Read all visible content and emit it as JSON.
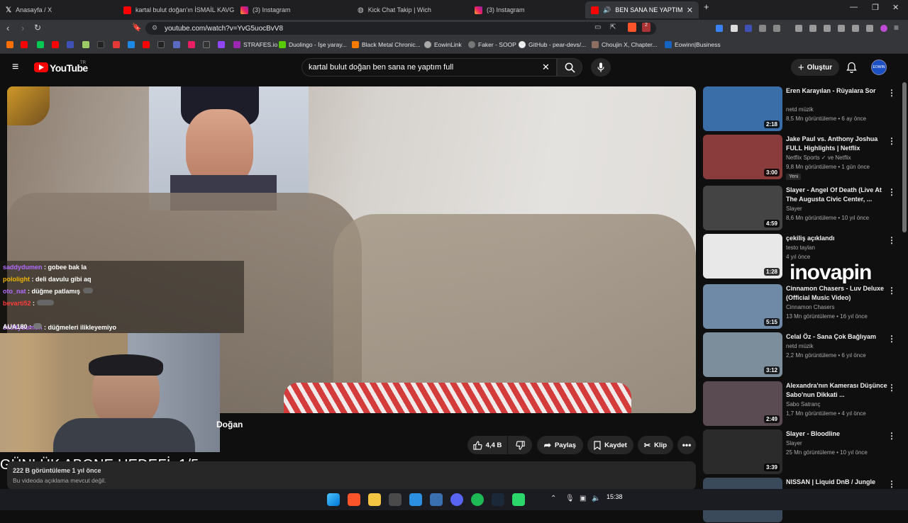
{
  "browser": {
    "tabs": [
      {
        "title": "Anasayfa / X",
        "icon": "x-logo-icon"
      },
      {
        "title": "kartal bulut doğan'ın İSMAİL KAVGA",
        "icon": "youtube-icon"
      },
      {
        "title": "(3) Instagram",
        "icon": "instagram-icon"
      },
      {
        "title": "Kick Chat Takip | Wich",
        "icon": "globe-icon"
      },
      {
        "title": "(3) Instagram",
        "icon": "instagram-icon"
      },
      {
        "title": "BEN SANA NE YAPTIM (Saygı",
        "icon": "youtube-icon"
      }
    ],
    "new_tab": "+",
    "url": "youtube.com/watch?v=YvG5uocBvV8",
    "shield_badge": "2",
    "bookmarks": [
      {
        "label": "STRAFES.io",
        "icon": "strafes-icon"
      },
      {
        "label": "Duolingo - İşe yaray...",
        "icon": "duolingo-icon"
      },
      {
        "label": "Black Metal Chronic...",
        "icon": "blogger-icon"
      },
      {
        "label": "EowinLink",
        "icon": "globe-icon"
      },
      {
        "label": "Faker - SOOP",
        "icon": "soop-icon"
      },
      {
        "label": "GitHub - pear-devs/...",
        "icon": "github-icon"
      },
      {
        "label": "Choujin X, Chapter...",
        "icon": "manga-icon"
      },
      {
        "label": "Eowinn|Business",
        "icon": "business-icon"
      }
    ]
  },
  "youtube": {
    "logo": "YouTube",
    "logo_country": "TR",
    "search_query": "kartal bulut doğan ben sana ne yaptım full",
    "create_label": "Oluştur",
    "avatar_text": "EOWIN"
  },
  "overlay": {
    "chat": [
      {
        "user": "saddydumen",
        "msg": "gobee bak la",
        "color": "#b36bff"
      },
      {
        "user": "pololight",
        "msg": "deli davulu gibi aq",
        "color": "#f0b400"
      },
      {
        "user": "oto_nat",
        "msg": "düğme patlamış",
        "color": "#b36bff"
      },
      {
        "user": "bevarti52",
        "msg": "",
        "color": "#ff3b3b"
      },
      {
        "user": "saddydumen",
        "msg": "düğmeleri ilikleyemiyo",
        "color": "#b36bff"
      },
      {
        "user": "AUA180",
        "msg": "",
        "color": "#ffffff"
      }
    ],
    "goal_text": "GÜNLÜK ABONE HEDEFİ: 1/5",
    "watermark": "inovapin"
  },
  "video": {
    "title_fragment": "Doğan",
    "likes": "4,4 B",
    "share_label": "Paylaş",
    "save_label": "Kaydet",
    "clip_label": "Klip",
    "views": "222 B görüntüleme  1 yıl önce",
    "no_description": "Bu videoda açıklama mevcut değil."
  },
  "recommendations": [
    {
      "title": "Eren Karayılan - Rüyalara Sor",
      "channel": "netd müzik",
      "meta": "8,5 Mn görüntüleme • 6 ay önce",
      "duration": "2:18",
      "thumb_color": "#3a6ea8"
    },
    {
      "title": "Jake Paul vs. Anthony Joshua FULL Highlights | Netflix",
      "channel": "Netflix Sports ✓ ve Netflix",
      "meta": "9,8 Mn görüntüleme • 1 gün önce",
      "duration": "3:00",
      "badge": "Yeni",
      "thumb_color": "#8a3b3b"
    },
    {
      "title": "Slayer - Angel Of Death (Live At The Augusta Civic Center, ...",
      "channel": "Slayer",
      "meta": "8,6 Mn görüntüleme • 10 yıl önce",
      "duration": "4:59",
      "thumb_color": "#444444"
    },
    {
      "title": "çekiliş açıklandı",
      "channel": "testo taylan",
      "meta": "4 yıl önce",
      "duration": "1:28",
      "thumb_color": "#e8e8e8"
    },
    {
      "title": "Cinnamon Chasers - Luv Deluxe (Official Music Video)",
      "channel": "Cinnamon Chasers",
      "meta": "13 Mn görüntüleme • 16 yıl önce",
      "duration": "5:15",
      "thumb_color": "#6f8aa6"
    },
    {
      "title": "Celal Öz - Sana Çok Bağlıyam",
      "channel": "netd müzik",
      "meta": "2,2 Mn görüntüleme • 6 yıl önce",
      "duration": "3:12",
      "thumb_color": "#7c8e9c"
    },
    {
      "title": "Alexandra'nın Kamerası Düşünce Sabo'nun Dikkati ...",
      "channel": "Sabo Satranç",
      "meta": "1,7 Mn görüntüleme • 4 yıl önce",
      "duration": "2:49",
      "thumb_color": "#5a4a52"
    },
    {
      "title": "Slayer - Bloodline",
      "channel": "Slayer",
      "meta": "25 Mn görüntüleme • 10 yıl önce",
      "duration": "3:39",
      "thumb_color": "#2b2b2b"
    },
    {
      "title": "NISSAN | Liquid DnB / Jungle",
      "channel": "",
      "meta": "",
      "duration": "",
      "thumb_color": "#3a4a5a"
    }
  ],
  "taskbar": {
    "time": "15:38"
  }
}
